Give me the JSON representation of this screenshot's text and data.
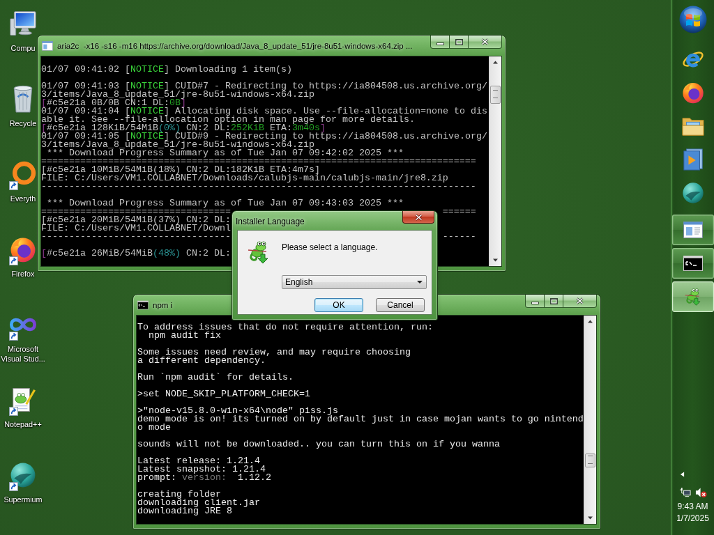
{
  "desktop_icons": [
    {
      "label": "Compu",
      "shortcut": false
    },
    {
      "label": "Recycle",
      "shortcut": false
    },
    {
      "label": "Everyth",
      "shortcut": true
    },
    {
      "label": "Firefox",
      "shortcut": true
    },
    {
      "label": "Microsoft Visual Stud...",
      "shortcut": true
    },
    {
      "label": "Notepad++",
      "shortcut": true
    },
    {
      "label": "Supermium",
      "shortcut": true
    }
  ],
  "console_windows": [
    {
      "title": "aria2c  -x16 -s16 -m16 https://archive.org/download/Java_8_update_51/jre-8u51-windows-x64.zip ...",
      "lines": [
        {
          "kind": "blank"
        },
        {
          "kind": "spans",
          "spans": [
            {
              "text": "01/07 09:41:02 ["
            },
            {
              "text": "NOTICE",
              "color": "#3ad43a"
            },
            {
              "text": "] Downloading 1 item(s)"
            }
          ]
        },
        {
          "kind": "blank"
        },
        {
          "kind": "spans",
          "spans": [
            {
              "text": "01/07 09:41:03 ["
            },
            {
              "text": "NOTICE",
              "color": "#3ad43a"
            },
            {
              "text": "] CUID#7 - Redirecting to https://ia804508.us.archive.org/"
            }
          ]
        },
        {
          "kind": "text",
          "text": "3/items/Java_8_update_51/jre-8u51-windows-x64.zip"
        },
        {
          "kind": "spans",
          "spans": [
            {
              "text": "[",
              "color": "#8a3a8a"
            },
            {
              "text": "#c5e21a 0B/0B CN:1 DL:"
            },
            {
              "text": "0B",
              "color": "#23a023"
            },
            {
              "text": "]",
              "color": "#8a3a8a"
            }
          ]
        },
        {
          "kind": "spans",
          "spans": [
            {
              "text": "01/07 09:41:04 ["
            },
            {
              "text": "NOTICE",
              "color": "#3ad43a"
            },
            {
              "text": "] Allocating disk space. Use --file-allocation=none to dis"
            }
          ]
        },
        {
          "kind": "text",
          "text": "able it. See --file-allocation option in man page for more details."
        },
        {
          "kind": "spans",
          "spans": [
            {
              "text": "[",
              "color": "#8a3a8a"
            },
            {
              "text": "#c5e21a 128KiB/54MiB"
            },
            {
              "text": "(0%)",
              "color": "#2b9494"
            },
            {
              "text": " CN:2 DL:"
            },
            {
              "text": "252KiB",
              "color": "#23a023"
            },
            {
              "text": " ETA:"
            },
            {
              "text": "3m40s",
              "color": "#23a023"
            },
            {
              "text": "]",
              "color": "#8a3a8a"
            }
          ]
        },
        {
          "kind": "spans",
          "spans": [
            {
              "text": "01/07 09:41:05 ["
            },
            {
              "text": "NOTICE",
              "color": "#3ad43a"
            },
            {
              "text": "] CUID#9 - Redirecting to https://ia804508.us.archive.org/"
            }
          ]
        },
        {
          "kind": "text",
          "text": "3/items/Java_8_update_51/jre-8u51-windows-x64.zip"
        },
        {
          "kind": "text",
          "text": " *** Download Progress Summary as of Tue Jan 07 09:42:02 2025 ***"
        },
        {
          "kind": "text",
          "text": "=============================================================================="
        },
        {
          "kind": "text",
          "text": "[#c5e21a 10MiB/54MiB(18%) CN:2 DL:182KiB ETA:4m7s]"
        },
        {
          "kind": "text",
          "text": "FILE: C:/Users/VM1.COLLABNET/Downloads/calubjs-main/calubjs-main/jre8.zip"
        },
        {
          "kind": "text",
          "text": "------------------------------------------------------------------------------"
        },
        {
          "kind": "blank"
        },
        {
          "kind": "text",
          "text": " *** Download Progress Summary as of Tue Jan 07 09:43:03 2025 ***"
        },
        {
          "kind": "text",
          "text": "==================================",
          "tail": "======"
        },
        {
          "kind": "text",
          "text": "[#c5e21a 20MiB/54MiB(37%) CN:2 DL:"
        },
        {
          "kind": "text",
          "text": "FILE: C:/Users/VM1.COLLABNET/Downl"
        },
        {
          "kind": "text",
          "text": "----------------------------------",
          "tail": "------"
        },
        {
          "kind": "blank"
        },
        {
          "kind": "spans",
          "spans": [
            {
              "text": "[",
              "color": "#8a3a8a"
            },
            {
              "text": "#c5e21a 26MiB/54MiB"
            },
            {
              "text": "(48%)",
              "color": "#2b9494"
            },
            {
              "text": " CN:2 DL:"
            }
          ]
        }
      ]
    },
    {
      "title": "npm i",
      "lines": [
        {
          "kind": "text",
          "text": "To address issues that do not require attention, run:"
        },
        {
          "kind": "text",
          "text": "  npm audit fix"
        },
        {
          "kind": "blank"
        },
        {
          "kind": "text",
          "text": "Some issues need review, and may require choosing"
        },
        {
          "kind": "text",
          "text": "a different dependency."
        },
        {
          "kind": "blank"
        },
        {
          "kind": "text",
          "text": "Run `npm audit` for details."
        },
        {
          "kind": "blank"
        },
        {
          "kind": "text",
          "text": ">set NODE_SKIP_PLATFORM_CHECK=1"
        },
        {
          "kind": "blank"
        },
        {
          "kind": "text",
          "text": ">\"node-v15.8.0-win-x64\\node\" piss.js"
        },
        {
          "kind": "text",
          "text": "demo mode is on! its turned on by default just in case mojan wants to go nintend"
        },
        {
          "kind": "text",
          "text": "o mode"
        },
        {
          "kind": "blank"
        },
        {
          "kind": "text",
          "text": "sounds will not be downloaded.. you can turn this on if you wanna"
        },
        {
          "kind": "blank"
        },
        {
          "kind": "text",
          "text": "Latest release: 1.21.4"
        },
        {
          "kind": "text",
          "text": "Latest snapshot: 1.21.4"
        },
        {
          "kind": "spans",
          "spans": [
            {
              "text": "prompt: "
            },
            {
              "text": "version:",
              "color": "#7a7a7a"
            },
            {
              "text": "  1.12.2"
            }
          ]
        },
        {
          "kind": "blank"
        },
        {
          "kind": "text",
          "text": "creating folder"
        },
        {
          "kind": "text",
          "text": "downloading client.jar"
        },
        {
          "kind": "text",
          "text": "downloading JRE 8"
        }
      ]
    }
  ],
  "dialog": {
    "title": "Installer Language",
    "message": "Please select a language.",
    "language": {
      "value": "English"
    },
    "buttons": [
      {
        "label": "OK",
        "focused": true
      },
      {
        "label": "Cancel",
        "focused": false
      }
    ]
  },
  "taskbar": {
    "running": [
      {
        "selected": false
      },
      {
        "selected": false
      },
      {
        "selected": true
      }
    ],
    "volume": {
      "muted": true
    },
    "clock": {
      "time": "9:43 AM",
      "date": "1/7/2025"
    }
  }
}
